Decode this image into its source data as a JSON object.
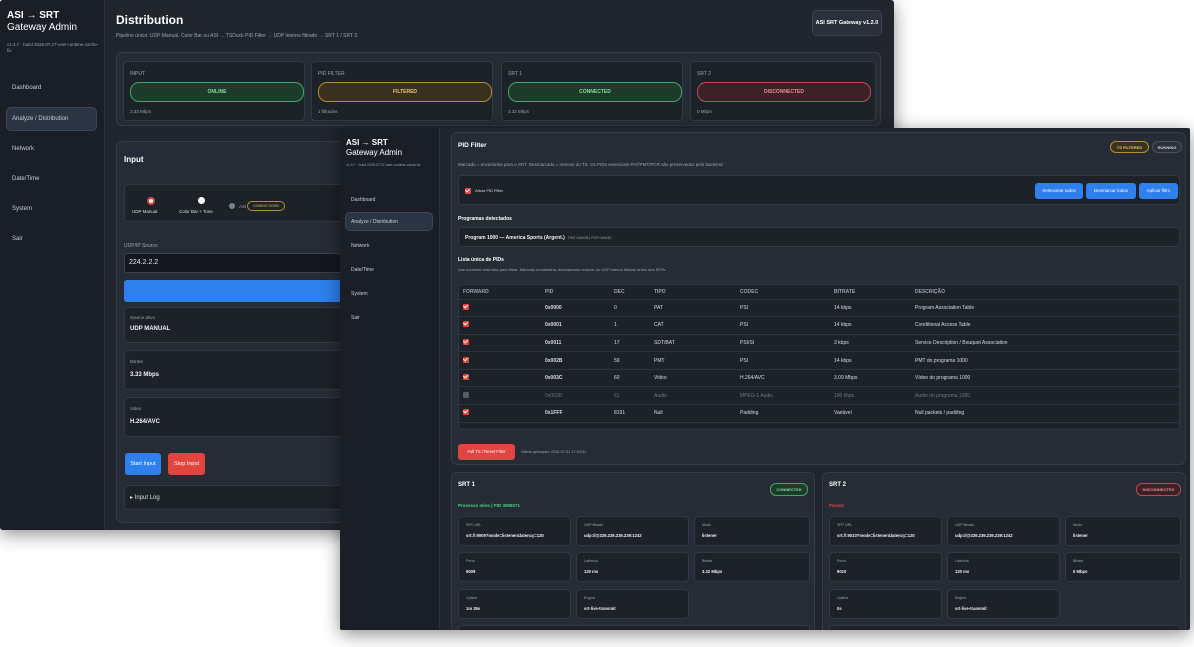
{
  "brand": {
    "line1": "ASI → SRT",
    "line2": "Gateway Admin",
    "version": "v1.3.7 · build 2026.07.27-user-runtime-cache-fix"
  },
  "nav": [
    {
      "label": "Dashboard"
    },
    {
      "label": "Analyze / Distribution"
    },
    {
      "label": "Network"
    },
    {
      "label": "Date/Time"
    },
    {
      "label": "System"
    },
    {
      "label": "Sair"
    }
  ],
  "back": {
    "page_title": "Distribution",
    "pipeline": "Pipeline único: UDP Manual, Color Bar ou ASI → TSDuck PID Filter → UDP interno filtrado → SRT 1 / SRT 2.",
    "version_badge": "ASI SRT Gateway v1.2.0",
    "status": [
      {
        "title": "INPUT",
        "pill": "ONLINE",
        "rate": "3.33 Mbps"
      },
      {
        "title": "PID FILTER",
        "pill": "FILTERED",
        "rate": "1 filtrados"
      },
      {
        "title": "SRT 1",
        "pill": "CONNECTED",
        "rate": "3.32 Mbps"
      },
      {
        "title": "SRT 2",
        "pill": "DISCONNECTED",
        "rate": "0 Mbps"
      }
    ],
    "input": {
      "title": "Input",
      "sources": [
        "UDP Manual",
        "Color Bar + Tone",
        "ASI"
      ],
      "asi_badge": "COMING SOON",
      "udp_label": "UDP/IP Source",
      "udp_value": "224.2.2.2",
      "fields": [
        {
          "label": "Source ativo",
          "value": "UDP MANUAL"
        },
        {
          "label": "Bitrate",
          "value": "3.33 Mbps"
        },
        {
          "label": "Video",
          "value": "H.264/AVC"
        }
      ],
      "start": "Start Input",
      "stop": "Stop Input",
      "log": "▸ Input Log"
    }
  },
  "front": {
    "pid_title": "PID Filter",
    "badge_filtered": "TS FILTERED",
    "badge_running": "RUNNING",
    "description": "Marcado = encaminha para o SRT. Desmarcado = remove do TS. Os PIDs essenciais PAT/PMT/PCR são preservados pelo backend.",
    "activate": "Ativar PID Filter",
    "btn_select": "Selecionar todos",
    "btn_deselect": "Desmarcar todos",
    "btn_apply": "Aplicar filtro",
    "programs_title": "Programas detectados",
    "program_name": "Program 1000 — America Sports (Argent.)",
    "program_meta": "PMT 0x002B | PCR 0x003C",
    "list_title": "Lista única de PIDs",
    "list_desc": "Use somente esta lista para filtrar. Marcado encaminha; desmarcado remove do UDP interno filtrado antes dos SRTs.",
    "columns": [
      "FORWARD",
      "PID",
      "DEC",
      "TIPO",
      "CODEC",
      "BITRATE",
      "DESCRIÇÃO"
    ],
    "rows": [
      {
        "checked": true,
        "pid": "0x0000",
        "dec": "0",
        "tipo": "PAT",
        "codec": "PSI",
        "bitrate": "14 kbps",
        "desc": "Program Association Table"
      },
      {
        "checked": true,
        "pid": "0x0001",
        "dec": "1",
        "tipo": "CAT",
        "codec": "PSI",
        "bitrate": "14 kbps",
        "desc": "Conditional Access Table"
      },
      {
        "checked": true,
        "pid": "0x0011",
        "dec": "17",
        "tipo": "SDT/BAT",
        "codec": "PSI/SI",
        "bitrate": "3 kbps",
        "desc": "Service Description / Bouquet Association"
      },
      {
        "checked": true,
        "pid": "0x002B",
        "dec": "59",
        "tipo": "PMT",
        "codec": "PSI",
        "bitrate": "14 kbps",
        "desc": "PMT do programa 1000"
      },
      {
        "checked": true,
        "pid": "0x003C",
        "dec": "60",
        "tipo": "Video",
        "codec": "H.264/AVC",
        "bitrate": "3.09 Mbps",
        "desc": "Vídeo do programa 1000"
      },
      {
        "checked": false,
        "pid": "0x003D",
        "dec": "61",
        "tipo": "Audio",
        "codec": "MPEG-1 Audio",
        "bitrate": "190 kbps",
        "desc": "Audio do programa 1000"
      },
      {
        "checked": true,
        "pid": "0x1FFF",
        "dec": "8191",
        "tipo": "Null",
        "codec": "Padding",
        "bitrate": "Variável",
        "desc": "Null packets / padding"
      }
    ],
    "reset_btn": "Full TS / Reset Filter",
    "last_apply": "Última aplicação: 2026-07-31 17:04:31",
    "srt1": {
      "title": "SRT 1",
      "badge": "CONNECTED",
      "status": "Processo ativo | PID 3058071",
      "fields": [
        {
          "label": "SRT URL",
          "value": "srt://:9009?mode=listener&latency=120"
        },
        {
          "label": "UDP filtrado",
          "value": "udp://@239.239.239.239:1242"
        },
        {
          "label": "Modo",
          "value": "listener"
        },
        {
          "label": "Porta",
          "value": "9009"
        },
        {
          "label": "Latência",
          "value": "120 ms"
        },
        {
          "label": "Bitrate",
          "value": "3.32 Mbps"
        },
        {
          "label": "Uptime",
          "value": "1m 39s"
        },
        {
          "label": "Engine",
          "value": "srt-live-transmit"
        }
      ]
    },
    "srt2": {
      "title": "SRT 2",
      "badge": "DISCONNECTED",
      "status": "Parado",
      "fields": [
        {
          "label": "SRT URL",
          "value": "srt://:9010?mode=listener&latency=120"
        },
        {
          "label": "UDP filtrado",
          "value": "udp://@239.239.239.239:1242"
        },
        {
          "label": "Modo",
          "value": "listener"
        },
        {
          "label": "Porta",
          "value": "9010"
        },
        {
          "label": "Latência",
          "value": "120 ms"
        },
        {
          "label": "Bitrate",
          "value": "0 Mbps"
        },
        {
          "label": "Uptime",
          "value": "0s"
        },
        {
          "label": "Engine",
          "value": "srt-live-transmit"
        }
      ]
    }
  }
}
